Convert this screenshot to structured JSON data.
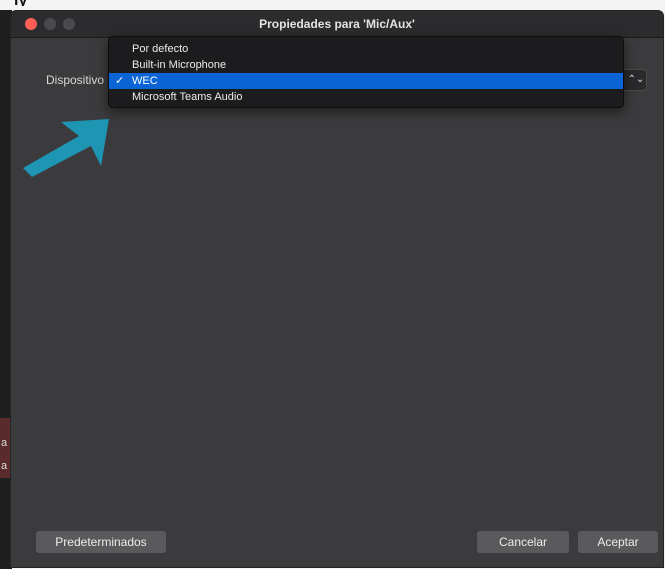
{
  "window": {
    "title": "Propiedades para 'Mic/Aux'"
  },
  "device": {
    "label": "Dispositivo",
    "selected_value": "WEC",
    "options": [
      {
        "label": "Por defecto",
        "selected": false
      },
      {
        "label": "Built-in Microphone",
        "selected": false
      },
      {
        "label": "WEC",
        "selected": true
      },
      {
        "label": "Microsoft Teams Audio",
        "selected": false
      }
    ],
    "check_mark": "✓",
    "stepper_icon": "⌃⌄"
  },
  "buttons": {
    "defaults": "Predeterminados",
    "cancel": "Cancelar",
    "accept": "Aceptar"
  },
  "colors": {
    "selection_blue": "#0a64d6",
    "annotation_arrow": "#1e95b3",
    "close_red": "#ff5f57"
  },
  "background_fragments": {
    "top": "ly",
    "left_1": "a",
    "left_2": "a"
  }
}
